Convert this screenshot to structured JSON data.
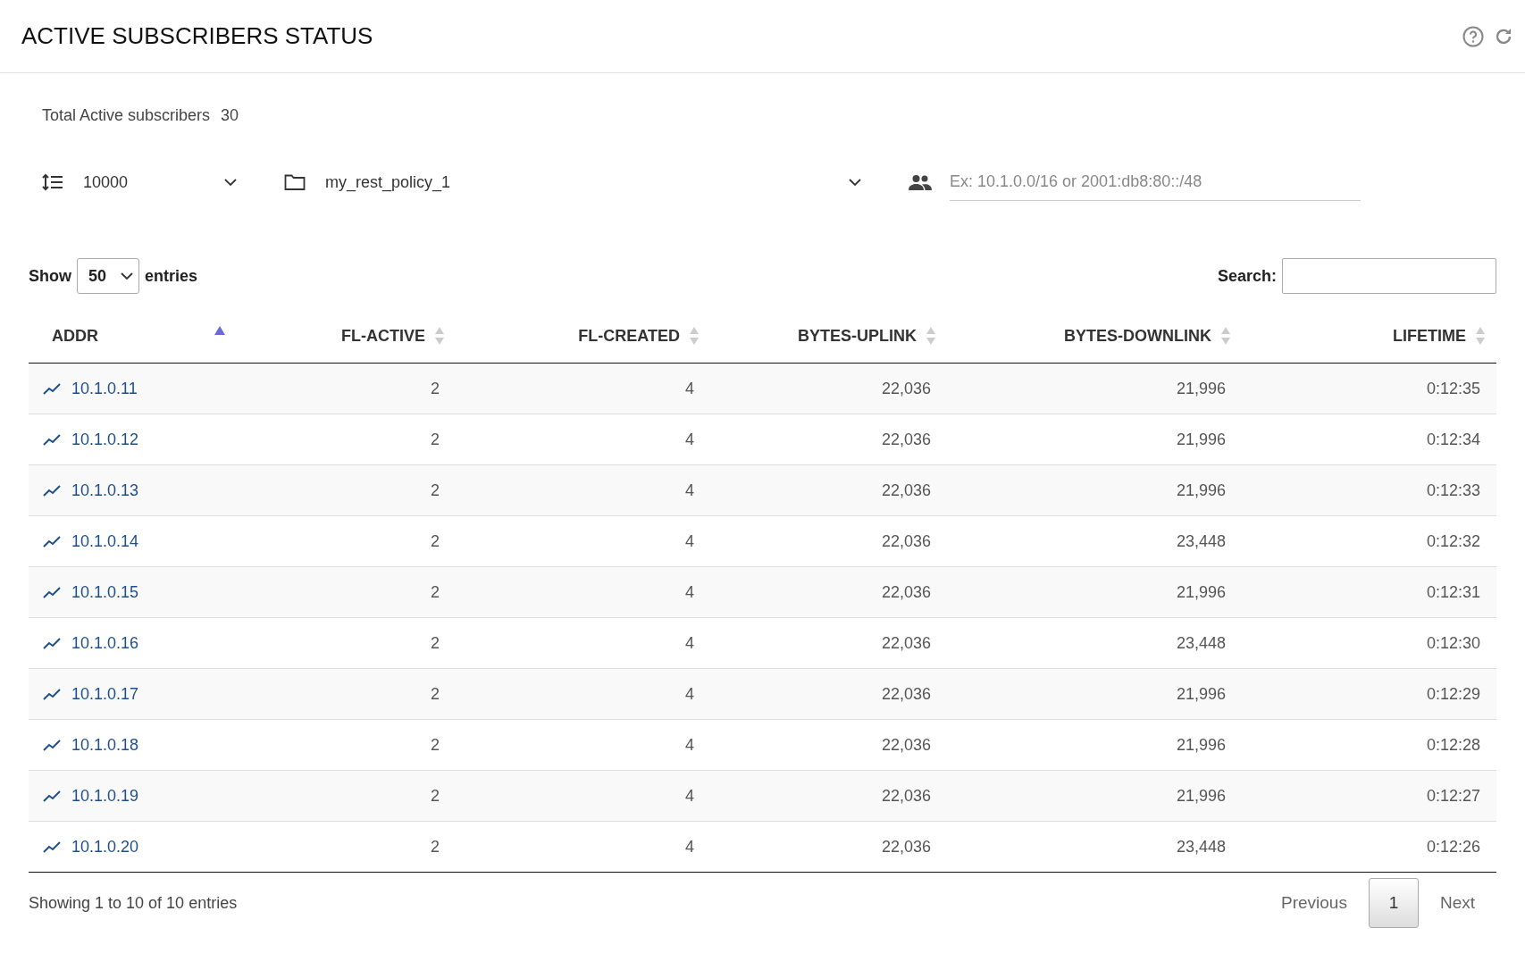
{
  "title": "ACTIVE SUBSCRIBERS STATUS",
  "total": {
    "label": "Total Active subscribers",
    "value": "30"
  },
  "filters": {
    "limit": "10000",
    "policy": "my_rest_policy_1",
    "subnet_placeholder": "Ex: 10.1.0.0/16 or 2001:db8:80::/48"
  },
  "length": {
    "before": "Show",
    "value": "50",
    "after": "entries"
  },
  "search": {
    "label": "Search:"
  },
  "columns": [
    {
      "label": "ADDR",
      "sorted": true
    },
    {
      "label": "FL-ACTIVE",
      "sorted": false
    },
    {
      "label": "FL-CREATED",
      "sorted": false
    },
    {
      "label": "BYTES-UPLINK",
      "sorted": false
    },
    {
      "label": "BYTES-DOWNLINK",
      "sorted": false
    },
    {
      "label": "LIFETIME",
      "sorted": false
    }
  ],
  "rows": [
    [
      "10.1.0.11",
      "2",
      "4",
      "22,036",
      "21,996",
      "0:12:35"
    ],
    [
      "10.1.0.12",
      "2",
      "4",
      "22,036",
      "21,996",
      "0:12:34"
    ],
    [
      "10.1.0.13",
      "2",
      "4",
      "22,036",
      "21,996",
      "0:12:33"
    ],
    [
      "10.1.0.14",
      "2",
      "4",
      "22,036",
      "23,448",
      "0:12:32"
    ],
    [
      "10.1.0.15",
      "2",
      "4",
      "22,036",
      "21,996",
      "0:12:31"
    ],
    [
      "10.1.0.16",
      "2",
      "4",
      "22,036",
      "23,448",
      "0:12:30"
    ],
    [
      "10.1.0.17",
      "2",
      "4",
      "22,036",
      "21,996",
      "0:12:29"
    ],
    [
      "10.1.0.18",
      "2",
      "4",
      "22,036",
      "21,996",
      "0:12:28"
    ],
    [
      "10.1.0.19",
      "2",
      "4",
      "22,036",
      "21,996",
      "0:12:27"
    ],
    [
      "10.1.0.20",
      "2",
      "4",
      "22,036",
      "23,448",
      "0:12:26"
    ]
  ],
  "info": "Showing 1 to 10 of 10 entries",
  "pagination": {
    "previous": "Previous",
    "pages": [
      {
        "label": "1",
        "selected": true
      }
    ],
    "next": "Next"
  }
}
